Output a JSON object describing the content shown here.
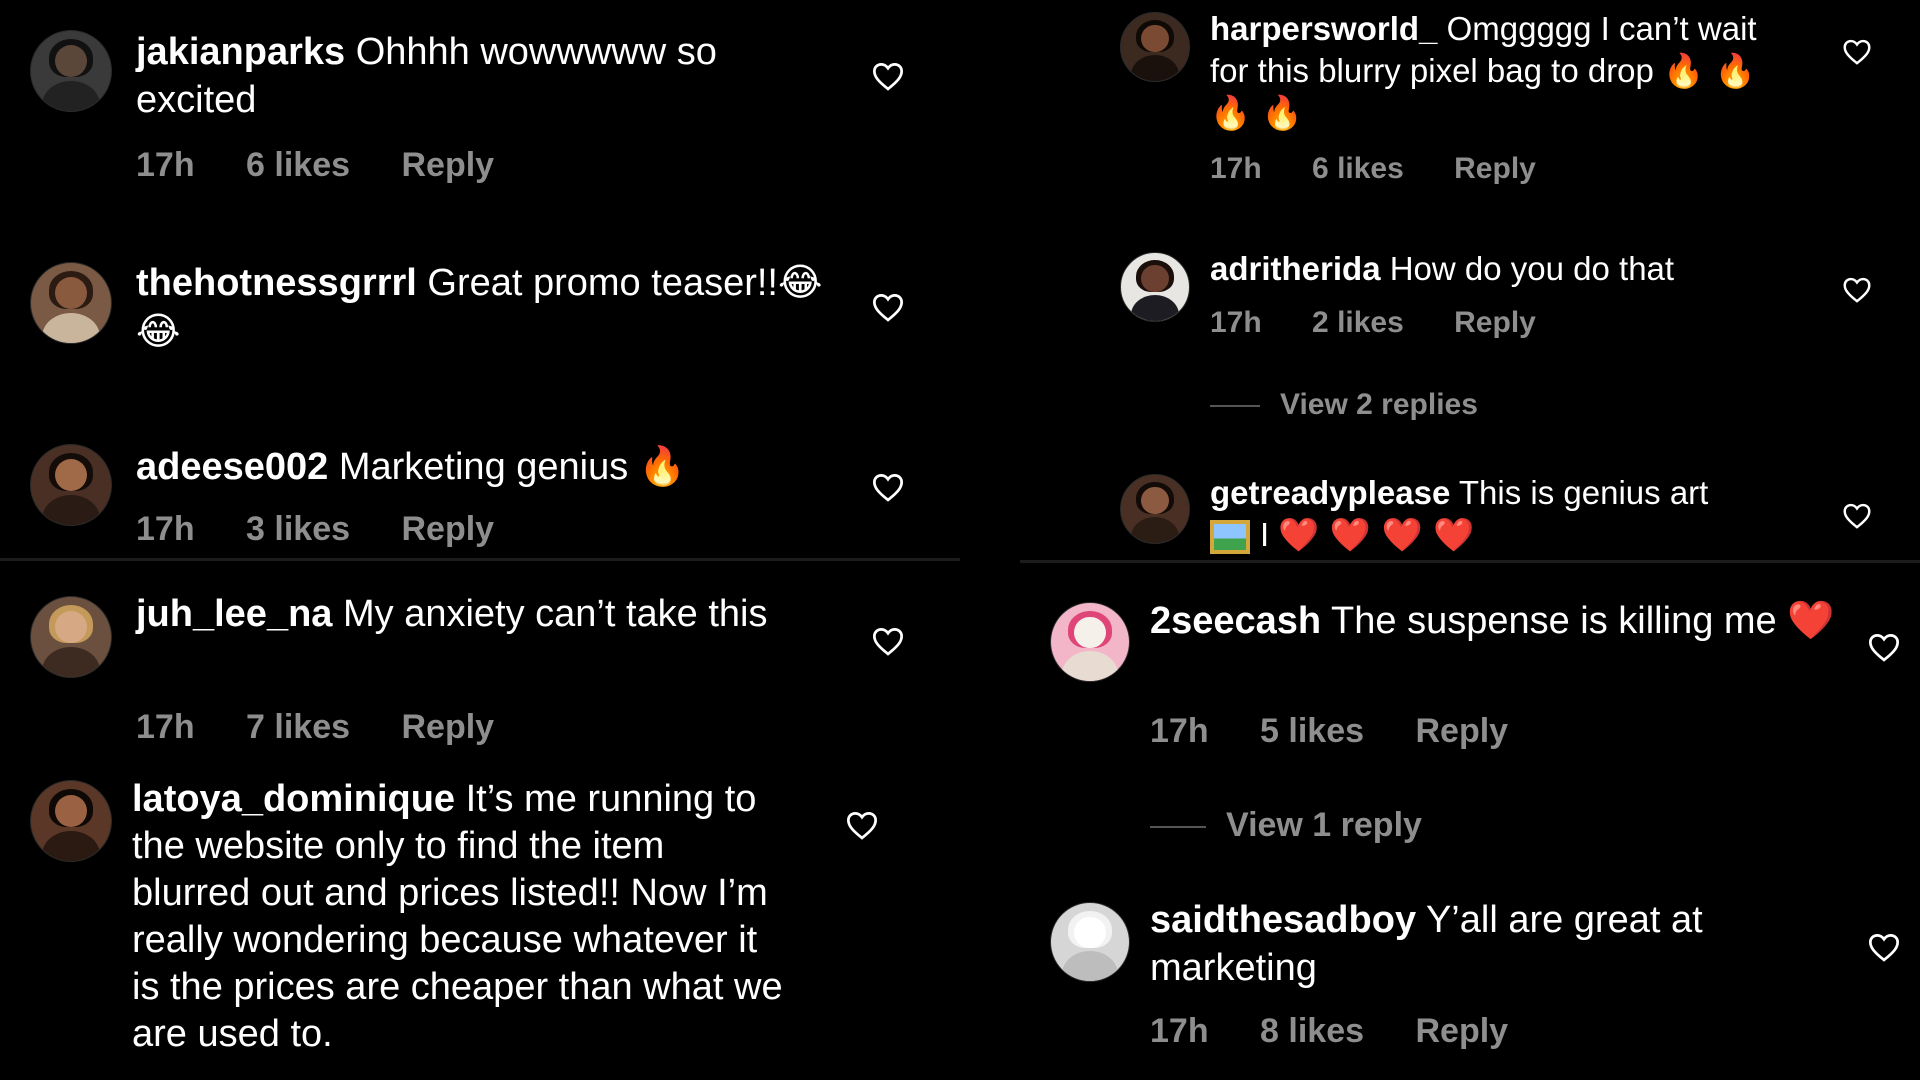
{
  "comments": {
    "c1": {
      "username": "jakianparks",
      "text": "Ohhhh wowwwww so excited",
      "time": "17h",
      "likes": "6 likes",
      "reply": "Reply"
    },
    "c2": {
      "username": "thehotnessgrrrl",
      "text": "Great promo teaser!!",
      "emoji": "😂 😂",
      "time": "",
      "likes": "",
      "reply": ""
    },
    "c3": {
      "username": "adeese002",
      "text": "Marketing genius",
      "emoji": "🔥",
      "time": "17h",
      "likes": "3 likes",
      "reply": "Reply"
    },
    "c4": {
      "username": "juh_lee_na",
      "text": "My anxiety can’t take this",
      "time": "17h",
      "likes": "7 likes",
      "reply": "Reply"
    },
    "c5": {
      "username": "latoya_dominique",
      "text": "It’s me running to the website only to find the item blurred out and prices listed!! Now I’m really wondering because whatever it is the prices are cheaper than what we are used to.",
      "time": "",
      "likes": "",
      "reply": ""
    },
    "c6": {
      "username": "harpersworld_",
      "text": "Omggggg I can’t wait for this blurry pixel bag to drop",
      "emoji": "🔥 🔥 🔥 🔥",
      "time": "17h",
      "likes": "6 likes",
      "reply": "Reply"
    },
    "c7": {
      "username": "adritherida",
      "text": "How do you do that",
      "time": "17h",
      "likes": "2 likes",
      "reply": "Reply",
      "view_replies": "View 2 replies"
    },
    "c8": {
      "username": "getreadyplease",
      "text": "This is genius art",
      "text2": "I",
      "emoji": "❤️ ❤️ ❤️ ❤️"
    },
    "c9": {
      "username": "2seecash",
      "text": "The suspense is killing me",
      "emoji": "❤️",
      "time": "17h",
      "likes": "5 likes",
      "reply": "Reply",
      "view_replies": "View 1 reply"
    },
    "c10": {
      "username": "saidthesadboy",
      "text": "Y’all are great at marketing",
      "time": "17h",
      "likes": "8 likes",
      "reply": "Reply"
    }
  },
  "icons": {
    "like": "heart-outline-icon",
    "avatar": "user-avatar"
  },
  "colors": {
    "background": "#000000",
    "text": "#ffffff",
    "meta": "#8e8e8e",
    "heart": "#ffffff",
    "fire": "#ff7a1a",
    "red_heart": "#e0142d"
  }
}
